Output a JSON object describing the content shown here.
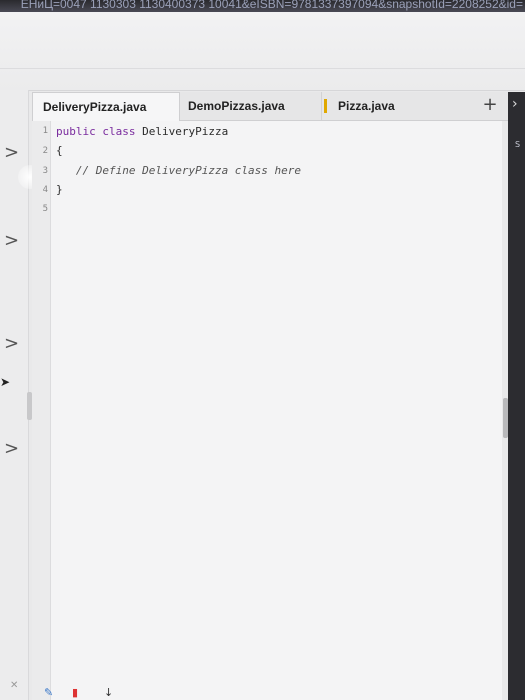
{
  "browser": {
    "url_fragment": "ЕНиЦ=0047 1130303 1130400373 10041&eISBN=9781337397094&snapshotId=2208252&id="
  },
  "tabs": [
    {
      "label": "DeliveryPizza.java",
      "active": true
    },
    {
      "label": "DemoPizzas.java",
      "active": false
    },
    {
      "label": "Pizza.java",
      "active": false
    }
  ],
  "toolbar": {
    "add_tab_symbol": "+"
  },
  "editor": {
    "line_numbers": [
      "1",
      "2",
      "3",
      "4",
      "5"
    ],
    "lines": [
      {
        "kw1": "public",
        "kw2": "class",
        "text": "DeliveryPizza"
      },
      {
        "text": "{"
      },
      {
        "text": "   // Define DeliveryPizza class here"
      },
      {
        "text": "}"
      },
      {
        "text": ""
      }
    ]
  },
  "sidebar": {
    "chevron_symbol": ">",
    "edge_letter": "S"
  },
  "colors": {
    "keyword": "#7a2c9e",
    "editor_bg": "#f4f4f5"
  }
}
